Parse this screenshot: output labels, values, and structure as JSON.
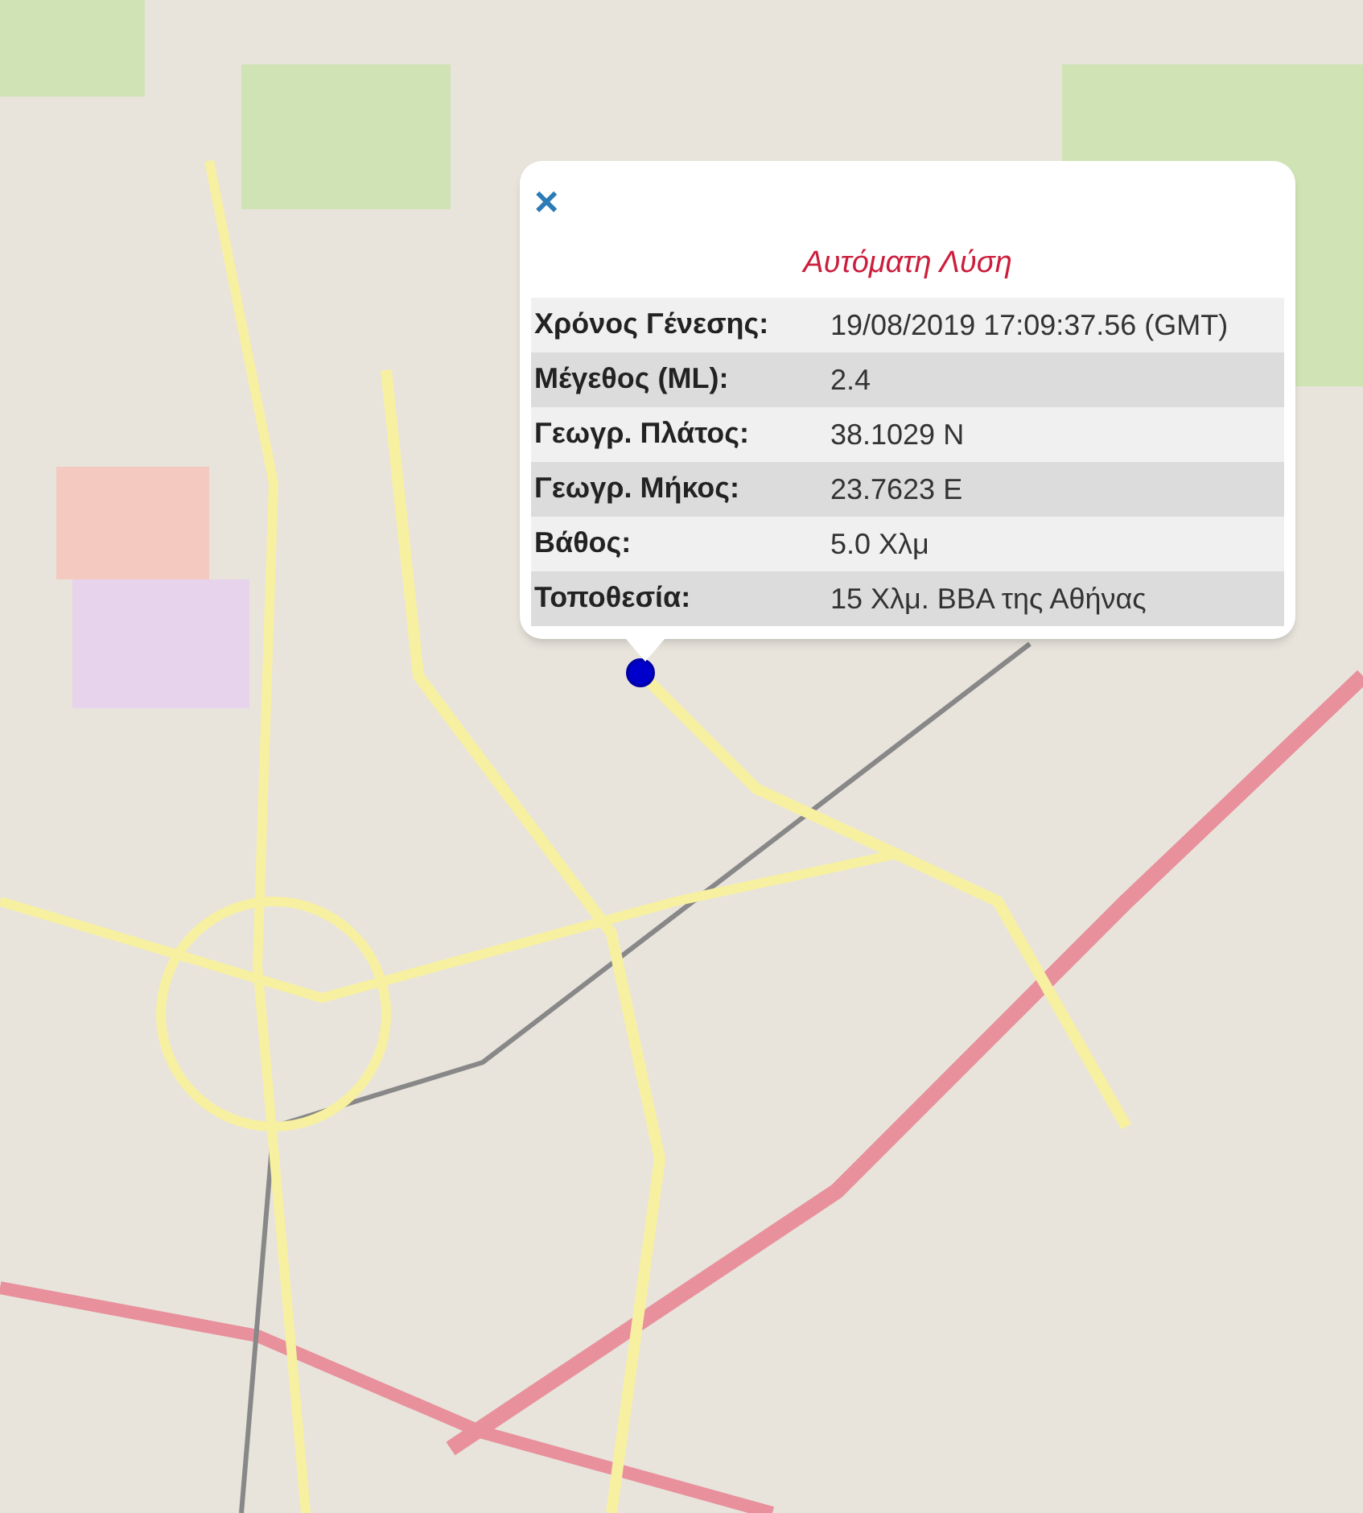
{
  "popup": {
    "close": "×",
    "title": "Αυτόματη Λύση",
    "rows": [
      {
        "label": "Χρόνος Γένεσης:",
        "value": "19/08/2019 17:09:37.56 (GMT)"
      },
      {
        "label": "Μέγεθος (ML):",
        "value": "2.4"
      },
      {
        "label": "Γεωγρ. Πλάτος:",
        "value": "38.1029 N"
      },
      {
        "label": "Γεωγρ. Μήκος:",
        "value": "23.7623 E"
      },
      {
        "label": "Βάθος:",
        "value": "5.0 Χλμ"
      },
      {
        "label": "Τοποθεσία:",
        "value": "15 Χλμ. ΒΒΑ της Αθήνας"
      }
    ]
  }
}
